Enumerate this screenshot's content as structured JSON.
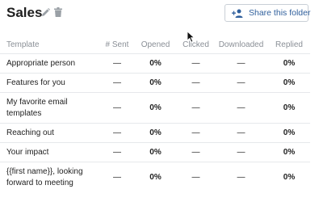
{
  "folder": {
    "title": "Sales",
    "icons": {
      "edit": "pencil-icon",
      "delete": "trash-icon"
    },
    "share_button": {
      "label": "Share this folder",
      "icon": "add-people-icon"
    }
  },
  "table": {
    "columns": [
      "Template",
      "# Sent",
      "Opened",
      "Clicked",
      "Downloaded",
      "Replied"
    ],
    "rows": [
      {
        "name": "Appropriate person",
        "sent": "—",
        "opened": "0%",
        "clicked": "—",
        "downloaded": "—",
        "replied": "0%"
      },
      {
        "name": "Features for you",
        "sent": "—",
        "opened": "0%",
        "clicked": "—",
        "downloaded": "—",
        "replied": "0%"
      },
      {
        "name": "My favorite email templates",
        "sent": "—",
        "opened": "0%",
        "clicked": "—",
        "downloaded": "—",
        "replied": "0%"
      },
      {
        "name": "Reaching out",
        "sent": "—",
        "opened": "0%",
        "clicked": "—",
        "downloaded": "—",
        "replied": "0%"
      },
      {
        "name": "Your impact",
        "sent": "—",
        "opened": "0%",
        "clicked": "—",
        "downloaded": "—",
        "replied": "0%"
      },
      {
        "name": "{{first name}}, looking forward to meeting",
        "sent": "—",
        "opened": "0%",
        "clicked": "—",
        "downloaded": "—",
        "replied": "0%"
      }
    ]
  },
  "colors": {
    "opened": "#2a62b6",
    "replied": "#9a3cbc",
    "share_text": "#2f5f9c"
  }
}
